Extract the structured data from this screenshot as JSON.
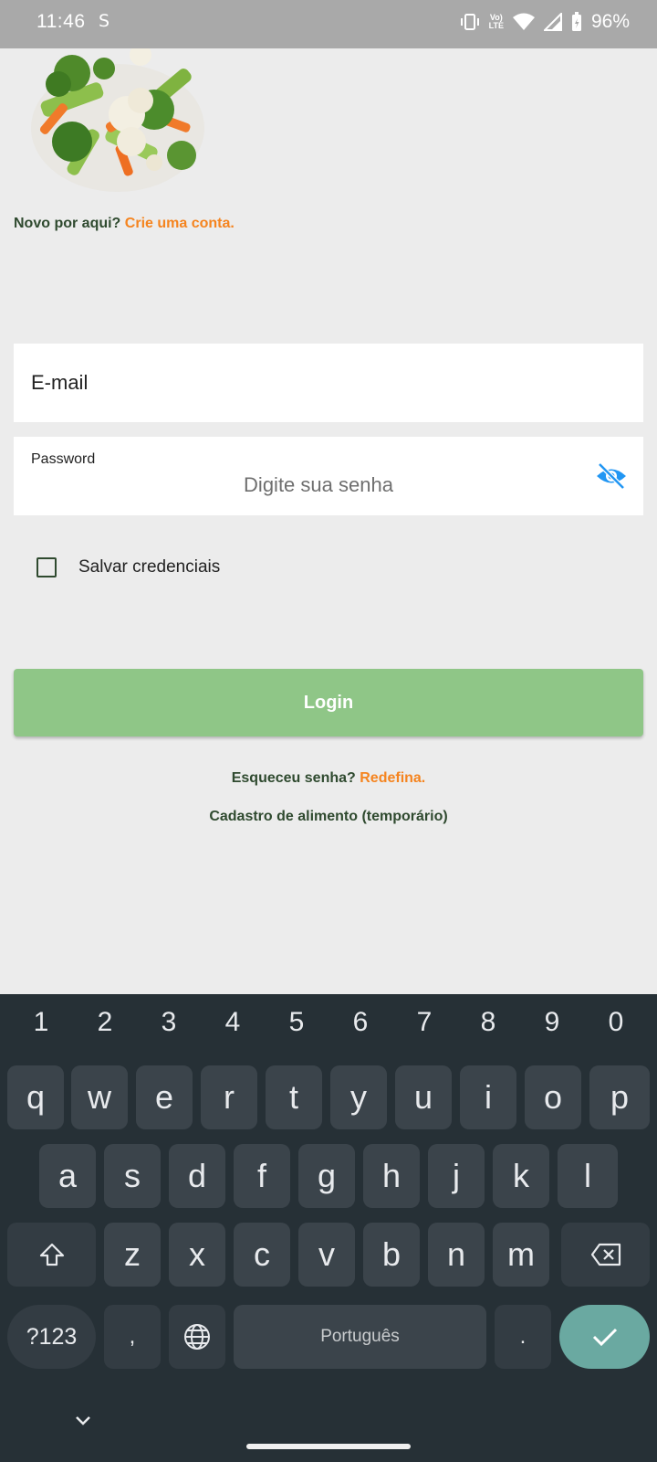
{
  "status": {
    "time": "11:46",
    "s_icon": "S",
    "lte": "Vo LTE",
    "battery": "96%"
  },
  "signup": {
    "prompt": "Novo por aqui?",
    "link": "Crie uma conta."
  },
  "email": {
    "label": "E-mail"
  },
  "password": {
    "label": "Password",
    "placeholder": "Digite sua senha"
  },
  "remember": {
    "label": "Salvar credenciais",
    "checked": false
  },
  "login": {
    "label": "Login"
  },
  "forgot": {
    "prompt": "Esqueceu senha?",
    "link": "Redefina."
  },
  "food": {
    "label": "Cadastro de alimento (temporário)"
  },
  "keyboard": {
    "numbers": [
      "1",
      "2",
      "3",
      "4",
      "5",
      "6",
      "7",
      "8",
      "9",
      "0"
    ],
    "row1": [
      "q",
      "w",
      "e",
      "r",
      "t",
      "y",
      "u",
      "i",
      "o",
      "p"
    ],
    "row2": [
      "a",
      "s",
      "d",
      "f",
      "g",
      "h",
      "j",
      "k",
      "l"
    ],
    "row3": [
      "z",
      "x",
      "c",
      "v",
      "b",
      "n",
      "m"
    ],
    "sym_label": "?123",
    "comma": ",",
    "space_label": "Português",
    "period": "."
  },
  "colors": {
    "accent_orange": "#f5841f",
    "login_green": "#8fc687",
    "dark_green_text": "#2f4a2f",
    "eye_blue": "#2196f3"
  }
}
